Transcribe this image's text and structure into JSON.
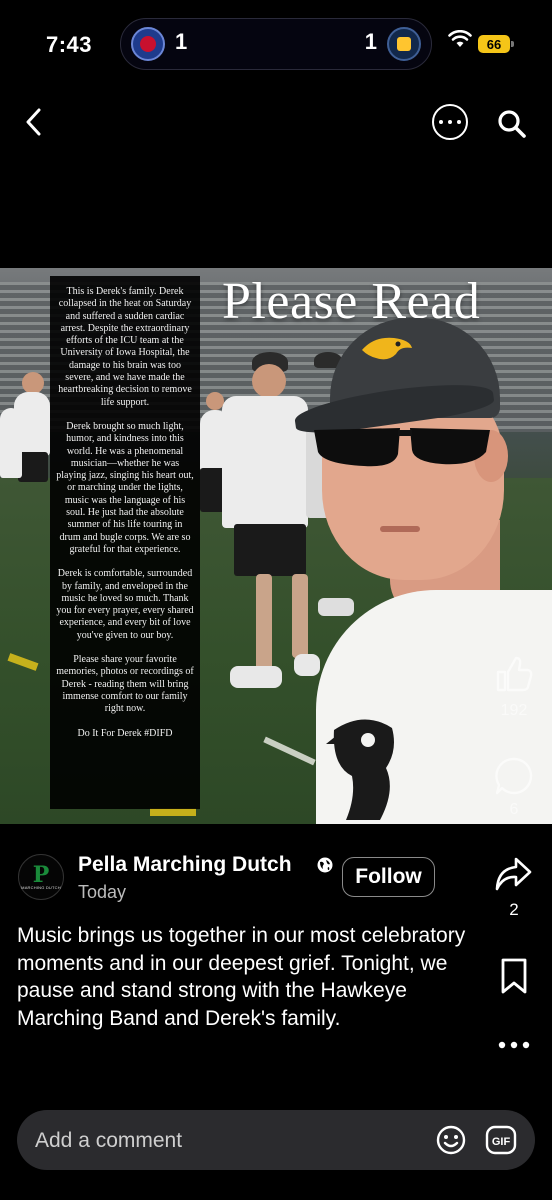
{
  "status_bar": {
    "time": "7:43",
    "score_left": "1",
    "score_right": "1",
    "battery": "66"
  },
  "media": {
    "overlay_title": "Please Read",
    "statement_paragraphs": [
      "This is Derek's family. Derek collapsed in the heat on Saturday and suffered a sudden cardiac arrest. Despite the extraordinary efforts of the ICU team at the University of Iowa Hospital, the damage to his brain was too severe, and we have made the heartbreaking decision to remove life support.",
      "Derek brought so much light, humor, and kindness into this world. He was a phenomenal musician—whether he was playing jazz, singing his heart out, or marching under the lights, music was the language of his soul. He just had the absolute summer of his life touring in drum and bugle corps. We are so grateful for that experience.",
      "Derek is comfortable, surrounded by family, and enveloped in the music he loved so much. Thank you for every prayer, every shared experience, and every bit of love you've given to our boy.",
      "Please share your favorite memories, photos or recordings of Derek - reading them will bring immense comfort to our family right now.",
      "Do It For Derek #DIFD"
    ]
  },
  "rail": {
    "like_count": "192",
    "comment_count": "6",
    "share_count": "2"
  },
  "post": {
    "author": "Pella Marching Dutch",
    "avatar_letter": "P",
    "avatar_text": "MARCHING DUTCH",
    "time": "Today",
    "follow_label": "Follow",
    "caption": "Music brings us together in our most celebratory moments and in our deepest grief. Tonight, we pause and stand strong with the Hawkeye Marching Band and Derek's family."
  },
  "comment_bar": {
    "placeholder": "Add a comment",
    "gif_label": "GIF"
  },
  "colors": {
    "background": "#000000",
    "battery": "#f5c518",
    "avatar_green": "#1a8a3a",
    "comment_bar": "#2b2b2e"
  },
  "icons": [
    "back-icon",
    "more-icon",
    "search-icon",
    "thumbs-up-icon",
    "comment-icon",
    "share-icon",
    "bookmark-icon",
    "more-horizontal-icon",
    "globe-icon",
    "emoji-icon",
    "gif-icon",
    "wifi-icon",
    "battery-icon"
  ]
}
